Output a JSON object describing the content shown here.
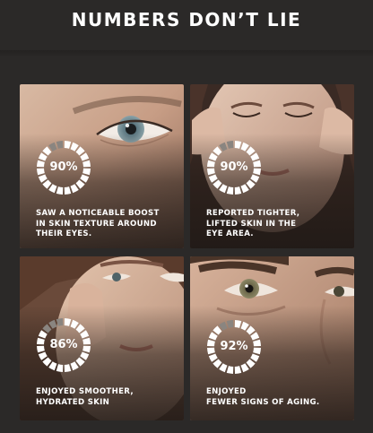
{
  "page": {
    "title": "NUMBERS DON’T LIE"
  },
  "cards": [
    {
      "percent_label": "90%",
      "percent": 90,
      "caption_lines": [
        "SAW A NOTICEABLE BOOST",
        "IN SKIN TEXTURE AROUND",
        "THEIR EYES."
      ]
    },
    {
      "percent_label": "90%",
      "percent": 90,
      "caption_lines": [
        "REPORTED TIGHTER,",
        "LIFTED SKIN IN THE",
        "EYE AREA."
      ]
    },
    {
      "percent_label": "86%",
      "percent": 86,
      "caption_lines": [
        "ENJOYED SMOOTHER,",
        "HYDRATED SKIN"
      ]
    },
    {
      "percent_label": "92%",
      "percent": 92,
      "caption_lines": [
        "ENJOYED",
        "FEWER SIGNS OF AGING."
      ]
    }
  ],
  "colors": {
    "background": "#2b2928",
    "text": "#ffffff",
    "ring_filled": "#ffffff",
    "ring_empty": "#8a8580"
  }
}
